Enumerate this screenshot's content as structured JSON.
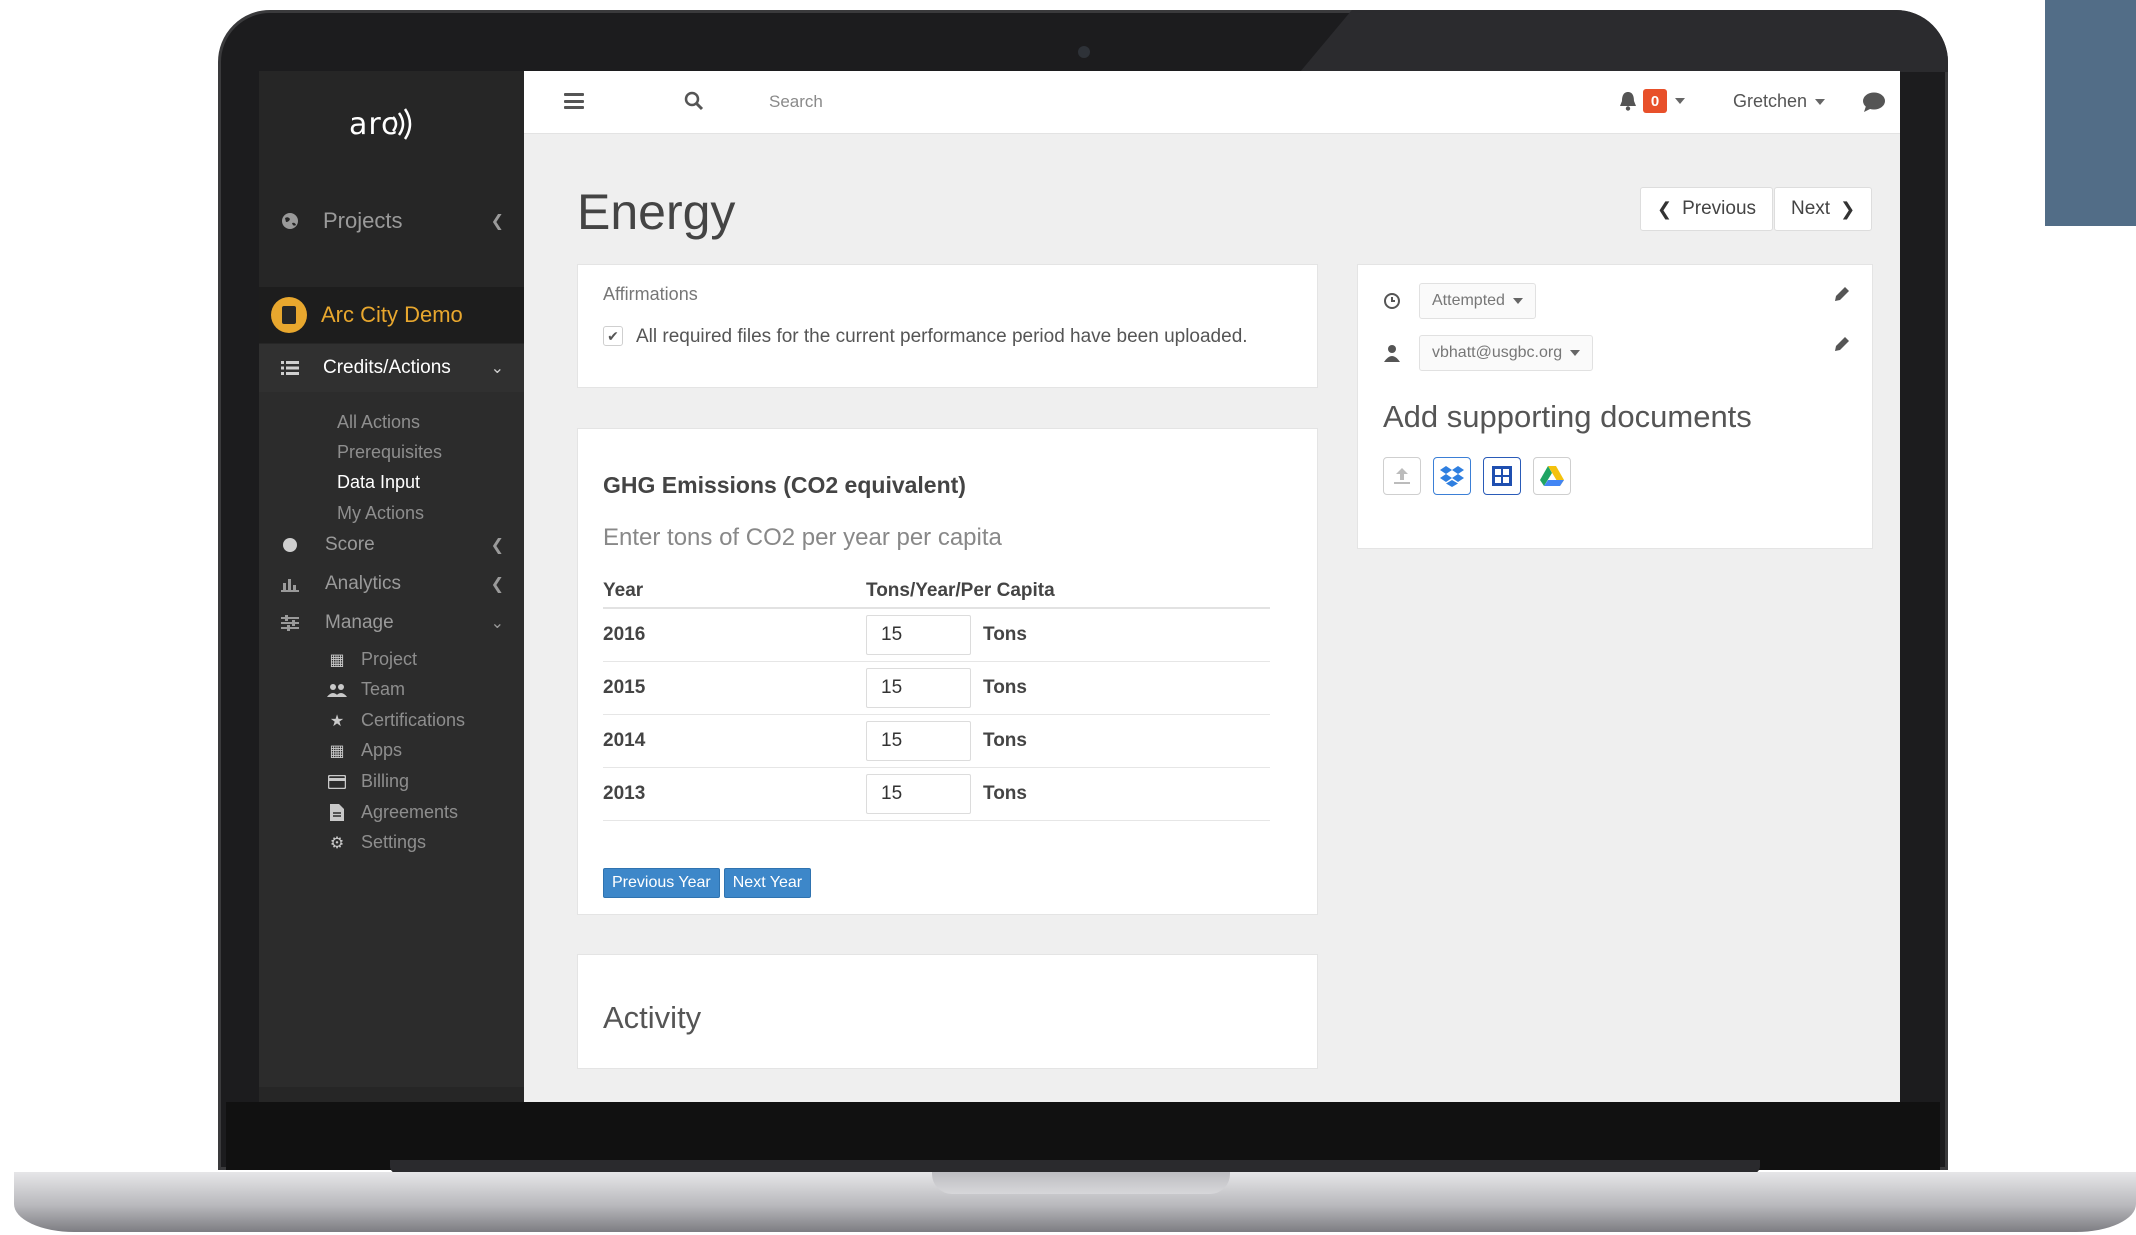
{
  "app": {
    "logo_text": "arc"
  },
  "sidebar": {
    "projects_label": "Projects",
    "demo_label": "Arc City Demo",
    "credits_label": "Credits/Actions",
    "sub_items": [
      "All Actions",
      "Prerequisites",
      "Data Input",
      "My Actions"
    ],
    "active_sub_item": "Data Input",
    "score_label": "Score",
    "analytics_label": "Analytics",
    "manage_label": "Manage",
    "manage_items": [
      "Project",
      "Team",
      "Certifications",
      "Apps",
      "Billing",
      "Agreements",
      "Settings"
    ],
    "colors": {
      "bg": "#262626",
      "accent": "#e8a72e"
    }
  },
  "topbar": {
    "search_placeholder": "Search",
    "notification_count": "0",
    "user_name": "Gretchen"
  },
  "page": {
    "title": "Energy",
    "previous_label": "Previous",
    "next_label": "Next"
  },
  "affirmations": {
    "title": "Affirmations",
    "checked": true,
    "text": "All required files for the current performance period have been uploaded."
  },
  "ghg": {
    "title": "GHG Emissions (CO2 equivalent)",
    "subtitle": "Enter tons of CO2 per year per capita",
    "columns": [
      "Year",
      "Tons/Year/Per Capita"
    ],
    "rows": [
      {
        "year": "2016",
        "value": "15",
        "unit": "Tons"
      },
      {
        "year": "2015",
        "value": "15",
        "unit": "Tons"
      },
      {
        "year": "2014",
        "value": "15",
        "unit": "Tons"
      },
      {
        "year": "2013",
        "value": "15",
        "unit": "Tons"
      }
    ],
    "previous_year_label": "Previous Year",
    "next_year_label": "Next Year",
    "button_color": "#3d87c9"
  },
  "activity": {
    "title": "Activity"
  },
  "side_panel": {
    "status_value": "Attempted",
    "assignee_value": "vbhatt@usgbc.org",
    "docs_title": "Add supporting documents",
    "doc_sources": [
      "upload-icon",
      "dropbox-icon",
      "onedrive-icon",
      "google-drive-icon"
    ]
  }
}
